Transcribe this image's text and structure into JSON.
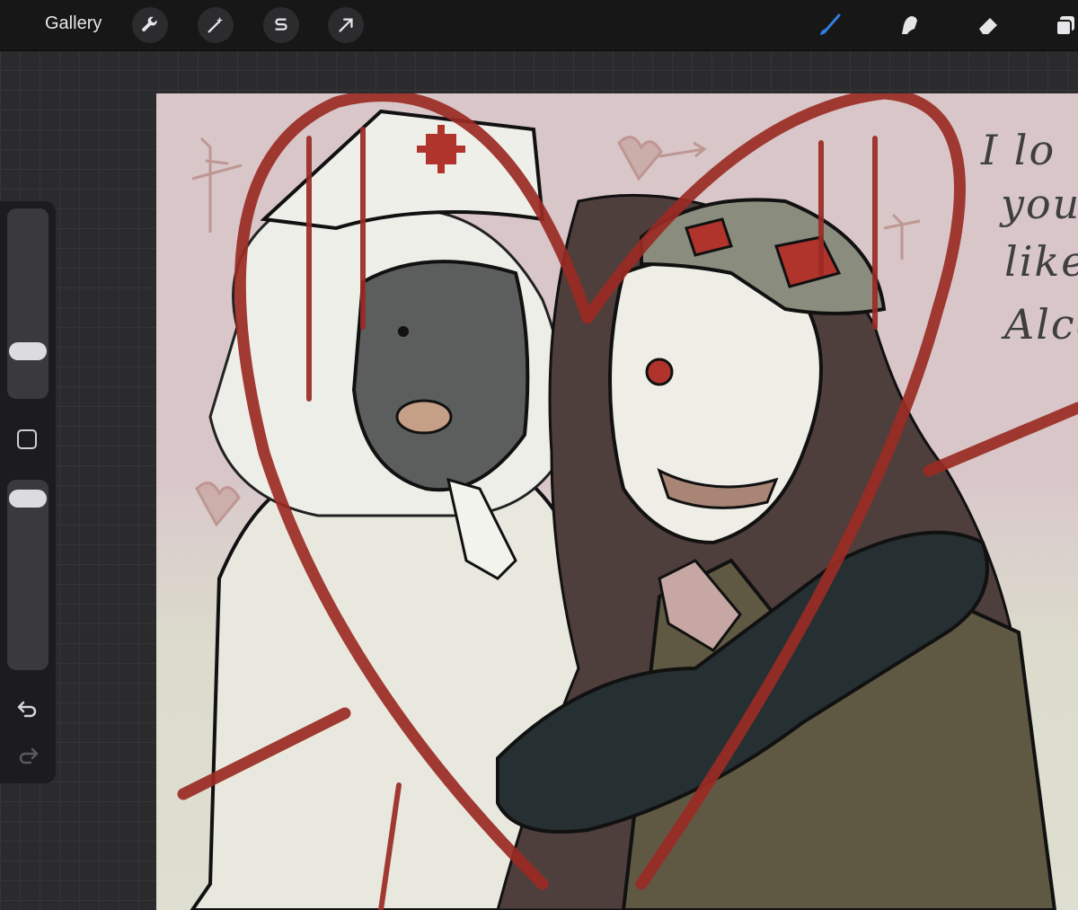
{
  "toolbar": {
    "gallery_label": "Gallery",
    "left_tools": [
      "wrench-icon",
      "magic-wand-icon",
      "selection-s-icon",
      "transform-arrow-icon"
    ],
    "right_tools": [
      "brush-icon",
      "smudge-icon",
      "eraser-icon",
      "layers-icon"
    ],
    "active_tool": "brush-icon",
    "accent_color": "#2f7fe0"
  },
  "sidebar": {
    "brush_size_level": 0.22,
    "brush_opacity_level": 0.05,
    "controls": [
      "brush-size-slider",
      "modify-button",
      "brush-opacity-slider",
      "undo-icon",
      "redo-icon"
    ]
  },
  "canvas": {
    "background_color": "#d8c6c8",
    "stroke_color": "#9a2b24",
    "handwriting_lines": [
      "I lo",
      "you",
      "like",
      "Alco"
    ]
  }
}
